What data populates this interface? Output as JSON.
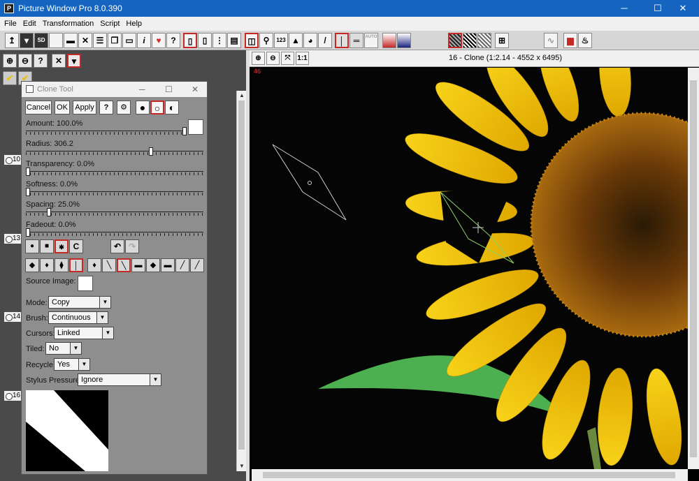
{
  "window": {
    "title": "Picture Window Pro 8.0.390",
    "icon_text": "P",
    "minimize": "─",
    "maximize": "☐",
    "close": "✕"
  },
  "menu": [
    "File",
    "Edit",
    "Transformation",
    "Script",
    "Help"
  ],
  "toolbar": {
    "help_label": "?",
    "number_label": "123",
    "auto_label": "AUTO",
    "ratio_label": "1:1",
    "info_label": "i"
  },
  "image_window": {
    "caption": "16 - Clone (1:2.14 - 4552 x 6495)",
    "zoom_in": "⊕",
    "zoom_out": "⊖",
    "fit": "⤧",
    "actual": "1:1"
  },
  "left_panel": {
    "thumb_numbers": [
      "10",
      "13",
      "14",
      "16"
    ],
    "overlay_number": "46"
  },
  "dialog": {
    "title": "Clone Tool",
    "cancel": "Cancel",
    "ok": "OK",
    "apply": "Apply",
    "help": "?",
    "sliders": [
      {
        "label": "Amount: 100.0%",
        "value": 100
      },
      {
        "label": "Radius: 306.2",
        "value": 72
      },
      {
        "label": "Transparency: 0.0%",
        "value": 0
      },
      {
        "label": "Softness: 0.0%",
        "value": 0
      },
      {
        "label": "Spacing: 25.0%",
        "value": 12
      },
      {
        "label": "Fadeout: 0.0%",
        "value": 0
      }
    ],
    "shape_c": "C",
    "source_image_label": "Source Image:",
    "fields": [
      {
        "label": "Mode:",
        "value": "Copy"
      },
      {
        "label": "Brush:",
        "value": "Continuous"
      },
      {
        "label": "Cursors:",
        "value": "Linked"
      },
      {
        "label": "Tiled:",
        "value": "No"
      },
      {
        "label": "Recycle:",
        "value": "Yes"
      },
      {
        "label": "Stylus Pressure:",
        "value": "Ignore"
      }
    ]
  }
}
